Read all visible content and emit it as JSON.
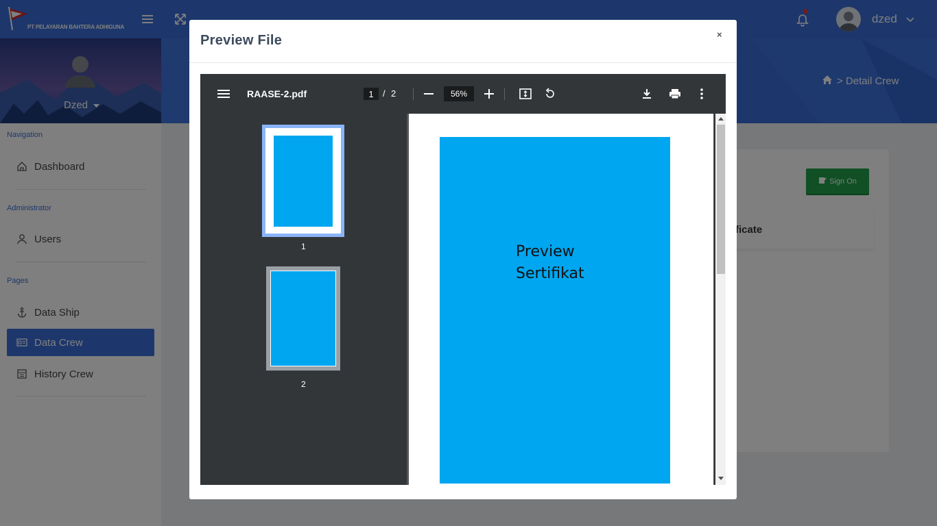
{
  "app": {
    "company_name": "PT PELAYARAN BAHTERA ADHIGUNA",
    "user_name": "dzed"
  },
  "sidebar": {
    "profile_name": "Dzed",
    "sections": [
      {
        "label": "Navigation"
      },
      {
        "label": "Administrator"
      },
      {
        "label": "Pages"
      }
    ],
    "items": [
      {
        "label": "Dashboard",
        "icon": "home-icon"
      },
      {
        "label": "Users",
        "icon": "user-icon"
      },
      {
        "label": "Data Ship",
        "icon": "anchor-icon"
      },
      {
        "label": "Data Crew",
        "icon": "id-card-icon",
        "active": true
      },
      {
        "label": "History Crew",
        "icon": "history-icon"
      }
    ]
  },
  "header": {
    "breadcrumb": "> Detail Crew"
  },
  "content": {
    "signon_label": "Sign On",
    "cert_label": "ficate"
  },
  "modal": {
    "title": "Preview File",
    "close": "×"
  },
  "pdf": {
    "file_name": "RAASE-2.pdf",
    "current_page": "1",
    "separator": "/",
    "total_pages": "2",
    "zoom": "56%",
    "thumb_labels": [
      "1",
      "2"
    ],
    "page_text_line1": "Preview",
    "page_text_line2": "Sertifikat"
  },
  "colors": {
    "brand": "#3a6fd8",
    "page_fill": "#00a6f0",
    "signon": "#20a048"
  }
}
